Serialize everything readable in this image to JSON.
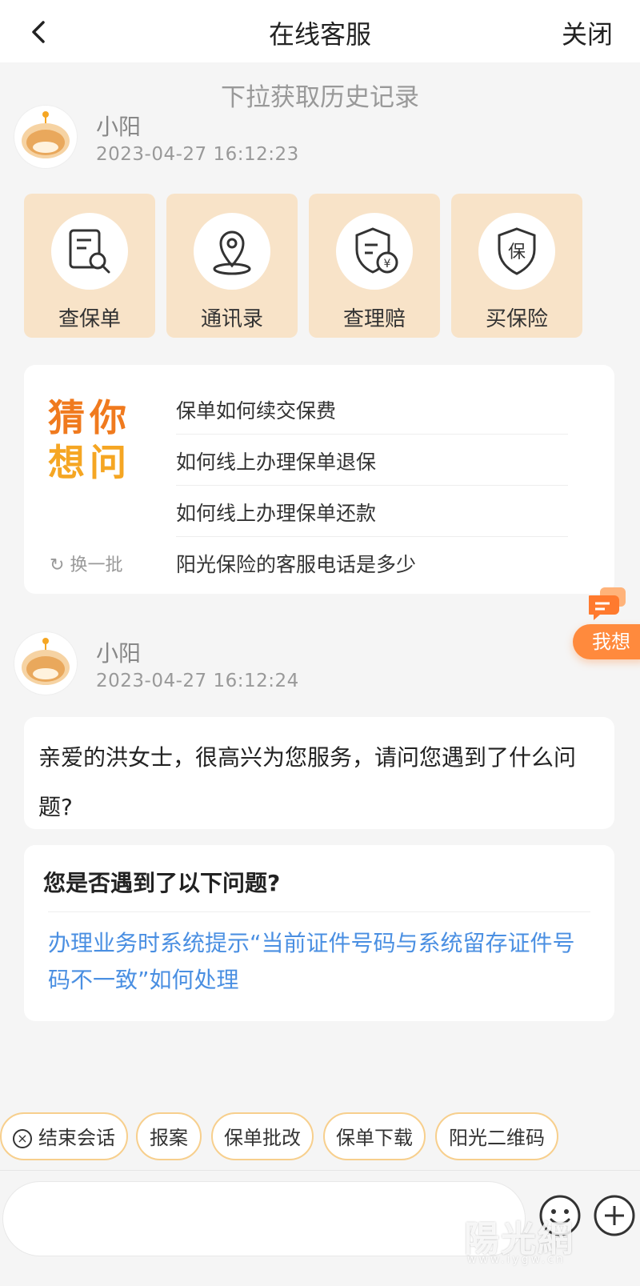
{
  "header": {
    "title": "在线客服",
    "close_label": "关闭"
  },
  "pull_hint": "下拉获取历史记录",
  "messages": [
    {
      "sender": "小阳",
      "time": "2023-04-27 16:12:23"
    },
    {
      "sender": "小阳",
      "time": "2023-04-27 16:12:24",
      "text": "亲爱的洪女士，很高兴为您服务，请问您遇到了什么问题?"
    }
  ],
  "quick_actions": [
    {
      "label": "查保单",
      "icon": "policy-search-icon"
    },
    {
      "label": "通讯录",
      "icon": "location-pin-icon"
    },
    {
      "label": "查理赔",
      "icon": "claim-shield-icon"
    },
    {
      "label": "买保险",
      "icon": "insurance-shield-icon"
    }
  ],
  "guess": {
    "title_line1": "猜你",
    "title_line2": "想问",
    "refresh_label": "换一批",
    "questions": [
      "保单如何续交保费",
      "如何线上办理保单退保",
      "如何线上办理保单还款",
      "阳光保险的客服电话是多少"
    ]
  },
  "problem_card": {
    "title": "您是否遇到了以下问题?",
    "link": "办理业务时系统提示“当前证件号码与系统留存证件号码不一致”如何处理"
  },
  "floating_button": {
    "label": "我想"
  },
  "chips": [
    "结束会话",
    "报案",
    "保单批改",
    "保单下载",
    "阳光二维码"
  ],
  "watermark": {
    "text": "陽光網",
    "sub": "www.iygw.cn"
  },
  "colors": {
    "accent": "#f07a1e",
    "link": "#4a8fe2",
    "quick_bg": "#f8e3c8",
    "chip_border": "#f7cf8d"
  }
}
